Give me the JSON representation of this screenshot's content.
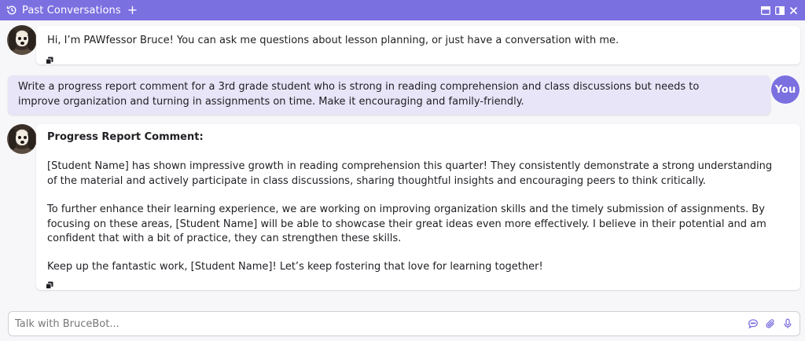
{
  "header": {
    "title": "Past Conversations",
    "add_label": "+"
  },
  "messages": [
    {
      "role": "bot",
      "text": "Hi, I’m PAWfessor Bruce! You can ask me questions about lesson planning, or just have a conversation with me."
    },
    {
      "role": "user",
      "avatar_label": "You",
      "text": "Write a progress report comment for a 3rd grade student who is strong in reading comprehension and class discussions but needs to improve organization and turning in assignments on time. Make it encouraging and family-friendly."
    },
    {
      "role": "bot",
      "heading": "Progress Report Comment:",
      "paragraphs": [
        "[Student Name] has shown impressive growth in reading comprehension this quarter! They consistently demonstrate a strong understanding of the material and actively participate in class discussions, sharing thoughtful insights and encouraging peers to think critically.",
        "To further enhance their learning experience, we are working on improving organization skills and the timely submission of assignments. By focusing on these areas, [Student Name] will be able to showcase their great ideas even more effectively. I believe in their potential and am confident that with a bit of practice, they can strengthen these skills.",
        "Keep up the fantastic work, [Student Name]! Let’s keep fostering that love for learning together!"
      ]
    }
  ],
  "input": {
    "placeholder": "Talk with BruceBot...",
    "value": ""
  },
  "colors": {
    "accent": "#7b70e0",
    "user_bubble": "#e7e5f7"
  },
  "icons": {
    "history": "history-icon",
    "copy": "copy-icon",
    "chat": "chat-bubble-icon",
    "attach": "paperclip-icon",
    "mic": "microphone-icon",
    "fullscreen": "maximize-window-icon",
    "sidebar": "sidebar-panel-icon",
    "close": "close-icon"
  }
}
